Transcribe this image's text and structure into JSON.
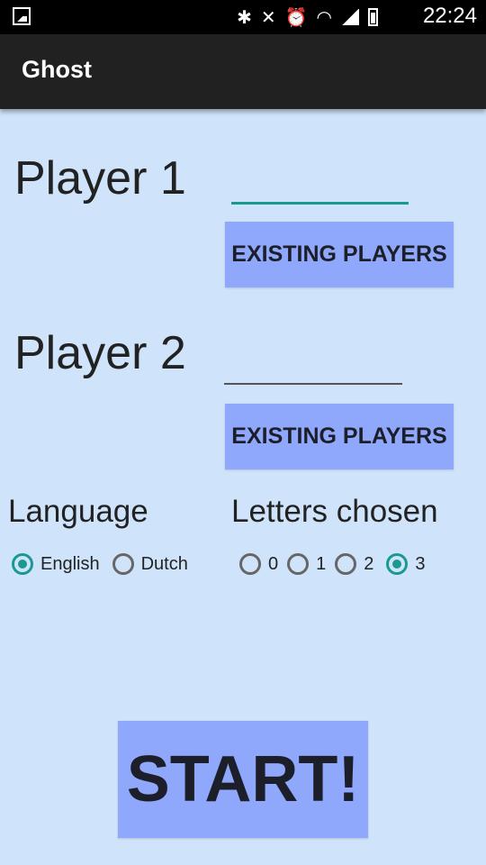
{
  "status_bar": {
    "time": "22:24",
    "icons": [
      "image-icon",
      "bluetooth-icon",
      "mute-icon",
      "alarm-icon",
      "wifi-icon",
      "signal-icon",
      "battery-icon"
    ]
  },
  "app_bar": {
    "title": "Ghost"
  },
  "player1": {
    "label": "Player 1",
    "value": "",
    "existing_button": "EXISTING PLAYERS"
  },
  "player2": {
    "label": "Player 2",
    "value": "",
    "existing_button": "EXISTING PLAYERS"
  },
  "language": {
    "label": "Language",
    "options": [
      {
        "label": "English",
        "checked": true
      },
      {
        "label": "Dutch",
        "checked": false
      }
    ]
  },
  "letters": {
    "label": "Letters chosen",
    "options": [
      {
        "label": "0",
        "checked": false
      },
      {
        "label": "1",
        "checked": false
      },
      {
        "label": "2",
        "checked": false
      },
      {
        "label": "3",
        "checked": true
      }
    ]
  },
  "start_button": "START!",
  "colors": {
    "background": "#cfe3fb",
    "button": "#8fa8fb",
    "accent": "#1a9a8f",
    "app_bar": "#212121"
  }
}
